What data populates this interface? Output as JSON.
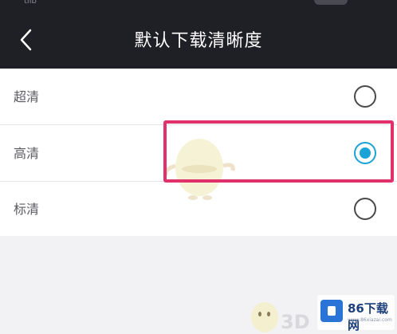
{
  "statusbar": {
    "left_text": "tilb",
    "toggle_icon": "toggle-pill"
  },
  "header": {
    "title": "默认下载清晰度",
    "back_icon": "chevron-left-icon"
  },
  "options": [
    {
      "label": "超清",
      "selected": false
    },
    {
      "label": "高清",
      "selected": true
    },
    {
      "label": "标清",
      "selected": false
    }
  ],
  "colors": {
    "header_bg": "#1f1f26",
    "accent": "#1aa3d6",
    "highlight": "#e0316a"
  },
  "watermark": {
    "brand": "86下载网",
    "url": "www.86xiazai.com",
    "overlay": "3D"
  }
}
